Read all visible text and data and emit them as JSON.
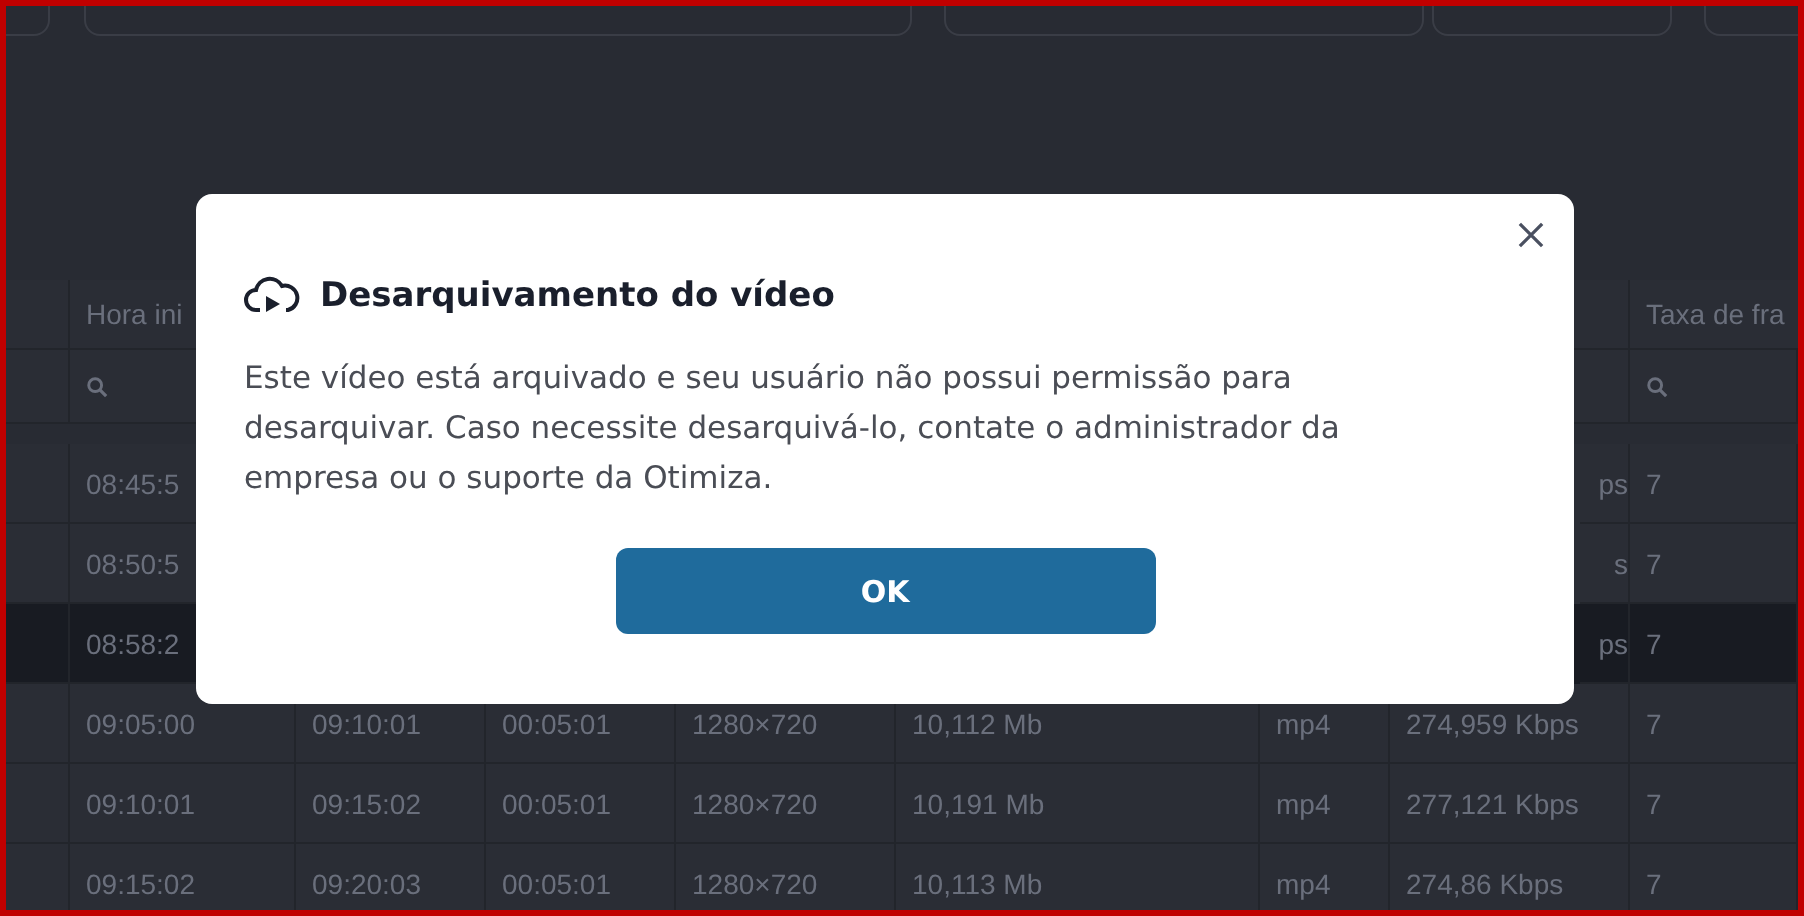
{
  "toolbar": {
    "fields": [
      {
        "kind": "button"
      },
      {
        "kind": "search"
      },
      {
        "kind": "date"
      },
      {
        "kind": "button"
      },
      {
        "kind": "button"
      }
    ]
  },
  "table": {
    "columns": [
      "",
      "Hora ini",
      "",
      "",
      "",
      "",
      "",
      "",
      "Taxa de fra"
    ],
    "filter_columns": [
      false,
      true,
      false,
      false,
      false,
      false,
      false,
      false,
      true
    ],
    "rows": [
      {
        "kind": "covered",
        "selected": false,
        "cells": [
          "08:45:5",
          "ps",
          "7"
        ]
      },
      {
        "kind": "covered",
        "selected": false,
        "cells": [
          "08:50:5",
          "s",
          "7"
        ]
      },
      {
        "kind": "covered",
        "selected": true,
        "cells": [
          "08:58:2",
          "ps",
          "7"
        ]
      },
      {
        "kind": "full",
        "selected": false,
        "cells": [
          "",
          "09:05:00",
          "09:10:01",
          "00:05:01",
          "1280×720",
          "10,112 Mb",
          "mp4",
          "274,959 Kbps",
          "7"
        ]
      },
      {
        "kind": "full",
        "selected": false,
        "cells": [
          "",
          "09:10:01",
          "09:15:02",
          "00:05:01",
          "1280×720",
          "10,191 Mb",
          "mp4",
          "277,121 Kbps",
          "7"
        ]
      },
      {
        "kind": "full",
        "selected": false,
        "cells": [
          "",
          "09:15:02",
          "09:20:03",
          "00:05:01",
          "1280×720",
          "10,113 Mb",
          "mp4",
          "274,86 Kbps",
          "7"
        ]
      }
    ]
  },
  "dialog": {
    "title": "Desarquivamento do vídeo",
    "message": "Este vídeo está arquivado e seu usuário não possui permissão para desarquivar. Caso necessite desarquivá-lo, contate o administrador da empresa ou o suporte da Otimiza.",
    "button": "OK"
  }
}
